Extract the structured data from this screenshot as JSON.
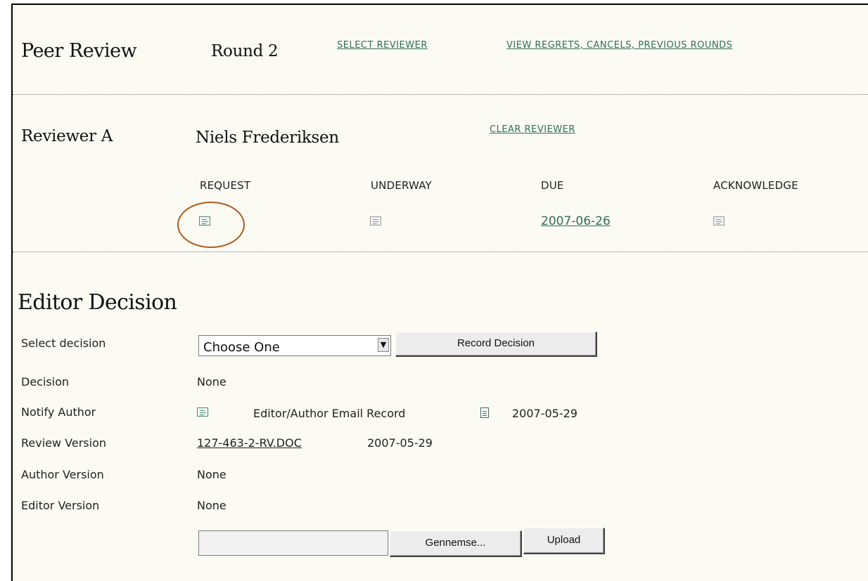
{
  "peer_review": {
    "title": "Peer Review",
    "round": "Round 2",
    "select_reviewer": "SELECT REVIEWER",
    "view_regrets": "VIEW REGRETS, CANCELS, PREVIOUS ROUNDS"
  },
  "reviewer": {
    "label": "Reviewer A",
    "name": "Niels Frederiksen",
    "clear_reviewer": "CLEAR REVIEWER",
    "columns": {
      "request": "REQUEST",
      "underway": "UNDERWAY",
      "due": "DUE",
      "acknowledge": "ACKNOWLEDGE"
    },
    "due_date": "2007-06-26",
    "icons": {
      "request": "mail-envelope-icon",
      "underway": "mail-envelope-icon-disabled",
      "acknowledge": "mail-envelope-icon-disabled"
    },
    "highlight_color": "#b05c1e"
  },
  "editor_decision": {
    "title": "Editor Decision",
    "rows": {
      "select_decision_label": "Select decision",
      "decision_select_value": "Choose One",
      "record_decision_button": "Record Decision",
      "decision_label": "Decision",
      "decision_value": "None",
      "notify_author_label": "Notify Author",
      "email_record_text": "Editor/Author Email Record",
      "email_record_date": "2007-05-29",
      "review_version_label": "Review Version",
      "review_version_file": "127-463-2-RV.DOC",
      "review_version_date": "2007-05-29",
      "author_version_label": "Author Version",
      "author_version_value": "None",
      "editor_version_label": "Editor Version",
      "editor_version_value": "None",
      "browse_button": "Gennemse...",
      "upload_button": "Upload"
    }
  },
  "colors": {
    "background": "#fbfaf3",
    "link": "#2f6f5a"
  }
}
